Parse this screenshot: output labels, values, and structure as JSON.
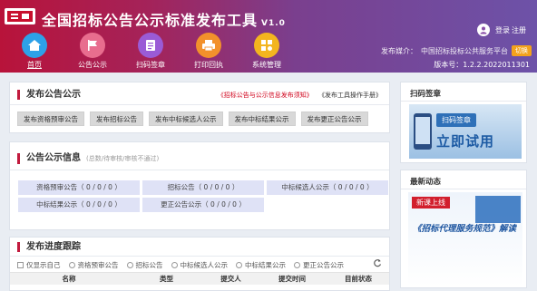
{
  "header": {
    "title": "全国招标公告公示标准发布工具",
    "version": "V1.0",
    "user_links": [
      "登录",
      "注册"
    ],
    "publish_media_label": "发布媒介：",
    "publish_media_value": "中国招标投标公共服务平台",
    "switch_label": "切换",
    "version_line": "版本号：1.2.2.2022011301",
    "brand_colors": {
      "start": "#b8133a",
      "end": "#6d52a8"
    }
  },
  "nav": [
    {
      "label": "首页",
      "icon": "home-icon",
      "color": "#2ea1e8"
    },
    {
      "label": "公告公示",
      "icon": "flag-icon",
      "color": "#e86d8e"
    },
    {
      "label": "扫码签章",
      "icon": "document-icon",
      "color": "#9a5bd6"
    },
    {
      "label": "打印回执",
      "icon": "printer-icon",
      "color": "#f2912b"
    },
    {
      "label": "系统管理",
      "icon": "settings-icon",
      "color": "#f3b51f"
    }
  ],
  "publish": {
    "title": "发布公告公示",
    "link_required": "《招标公告与公示信息发布须知》",
    "link_manual": "《发布工具操作手册》",
    "buttons": [
      "发布资格预审公告",
      "发布招标公告",
      "发布中标候选人公示",
      "发布中标结果公示",
      "发布更正公告公示"
    ]
  },
  "info": {
    "title": "公告公示信息",
    "subtitle": "(总数/待审核/审核不通过)",
    "cells": [
      "资格预审公告（ 0 / 0 / 0 ）",
      "招标公告（ 0 / 0 / 0 ）",
      "中标候选人公示（ 0 / 0 / 0 ）",
      "中标结果公示（ 0 / 0 / 0 ）",
      "更正公告公示（ 0 / 0 / 0 ）"
    ]
  },
  "progress": {
    "title": "发布进度跟踪",
    "only_mine": "仅显示自己",
    "filters": [
      "资格预审公告",
      "招标公告",
      "中标候选人公示",
      "中标结果公示",
      "更正公告公示"
    ],
    "columns": [
      "名称",
      "类型",
      "提交人",
      "提交时间",
      "目前状态"
    ]
  },
  "scan": {
    "title": "扫码签章",
    "banner_tag": "扫码签章",
    "banner_text": "立即试用"
  },
  "news": {
    "title": "最新动态",
    "banner_tag": "新课上线",
    "banner_text": "《招标代理服务规范》解读"
  }
}
